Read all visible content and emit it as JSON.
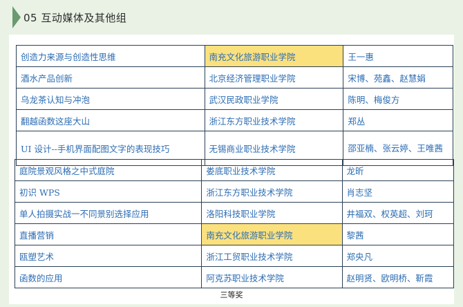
{
  "section": {
    "title": "05 互动媒体及其他组"
  },
  "table_top": [
    {
      "topic": "创造力来源与创造性思维",
      "school": "南充文化旅游职业学院",
      "authors": "王一惠",
      "highlight": true
    },
    {
      "topic": "酒水产品创新",
      "school": "北京经济管理职业学院",
      "authors": "宋博、苑鑫、赵慧娟",
      "highlight": false
    },
    {
      "topic": "乌龙茶认知与冲泡",
      "school": "武汉民政职业学院",
      "authors": "陈明、梅俊方",
      "highlight": false
    },
    {
      "topic": "翻越函数这座大山",
      "school": "浙江东方职业技术学院",
      "authors": "郑丛",
      "highlight": false
    },
    {
      "topic": "UI 设计--手机界面配图文字的表现技巧",
      "school": "无锡商业职业技术学院",
      "authors": "邵亚楠、张云婷、王唯茜",
      "highlight": false
    }
  ],
  "table_bottom": [
    {
      "topic": "庭院景观风格之中式庭院",
      "school": "娄底职业技术学院",
      "authors": "龙昕",
      "highlight": false
    },
    {
      "topic": "初识 WPS",
      "school": "浙江东方职业技术学院",
      "authors": "肖志坚",
      "highlight": false
    },
    {
      "topic": "单人拍摄实战一不同景别选择应用",
      "school": "洛阳科技职业学院",
      "authors": "井福双、权英超、刘珂",
      "highlight": false
    },
    {
      "topic": "直播营销",
      "school": "南充文化旅游职业学院",
      "authors": "黎茜",
      "highlight": true
    },
    {
      "topic": "瓯塑艺术",
      "school": "浙江工贸职业技术学院",
      "authors": "郑央凡",
      "highlight": false
    },
    {
      "topic": "函数的应用",
      "school": "阿克苏职业技术学院",
      "authors": "赵明贤、欧明桥、靳霞",
      "highlight": false
    }
  ],
  "footer": {
    "label": "三等奖"
  },
  "colors": {
    "text": "#2d6db3",
    "highlight": "#fbe17e",
    "border": "#2a3f55",
    "background": "#e9f2e4"
  }
}
